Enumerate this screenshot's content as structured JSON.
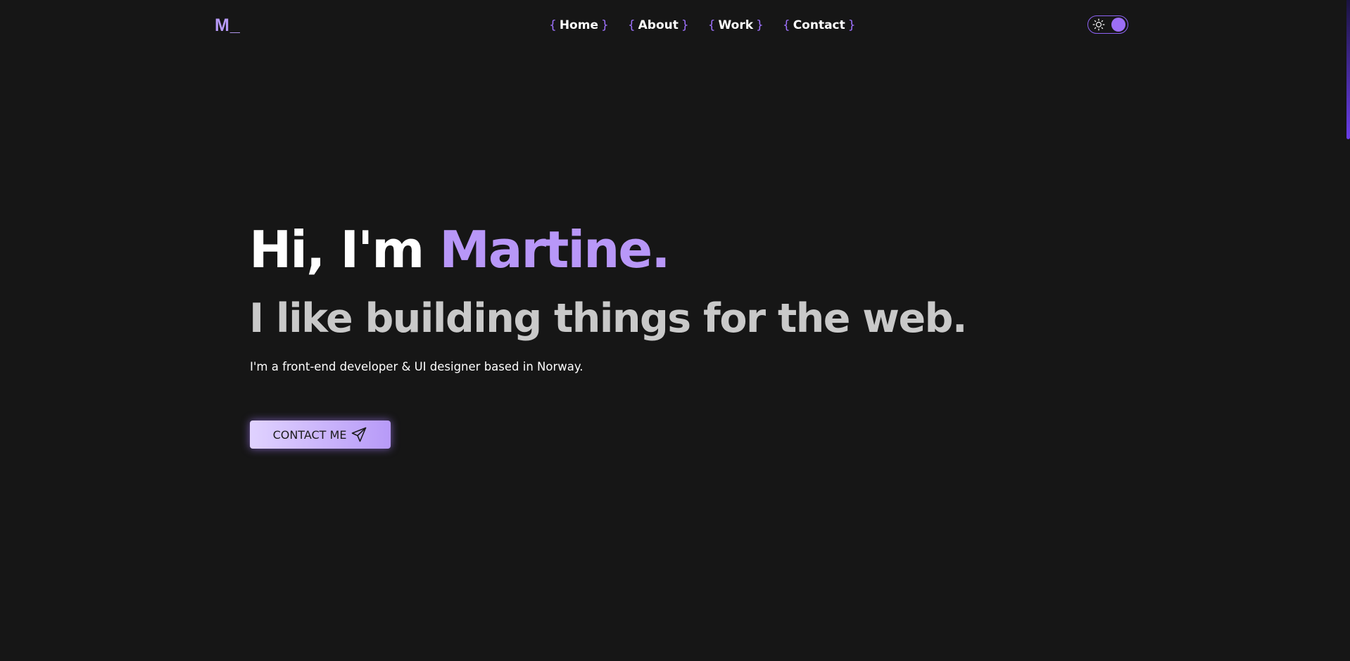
{
  "header": {
    "logo": "M_",
    "nav": {
      "open_brace": "{",
      "close_brace": "}",
      "items": [
        {
          "label": "Home"
        },
        {
          "label": "About"
        },
        {
          "label": "Work"
        },
        {
          "label": "Contact"
        }
      ]
    },
    "theme_toggle": {
      "icon": "sun-icon",
      "state": "dark"
    }
  },
  "hero": {
    "greeting_prefix": "Hi, I'm ",
    "greeting_name": "Martine.",
    "tagline": "I like building things for the web.",
    "intro": "I'm a front-end developer & UI designer based in Norway.",
    "cta_label": "CONTACT ME",
    "cta_icon": "send-icon"
  },
  "colors": {
    "background": "#161616",
    "accent": "#b897f8",
    "brace": "#9f72ff",
    "tagline": "#c9c9c9"
  }
}
